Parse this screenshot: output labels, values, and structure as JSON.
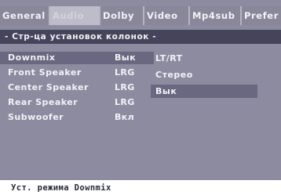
{
  "tabs": [
    {
      "label": "General",
      "active": false
    },
    {
      "label": "Audio",
      "active": true
    },
    {
      "label": "Dolby",
      "active": false
    },
    {
      "label": "Video",
      "active": false
    },
    {
      "label": "Mp4sub",
      "active": false
    },
    {
      "label": "Prefer",
      "active": false
    }
  ],
  "page_title": "- Стр-ца установок колонок -",
  "settings": [
    {
      "label": "Downmix",
      "value": "Вык",
      "selected": true
    },
    {
      "label": "Front Speaker",
      "value": "LRG",
      "selected": false
    },
    {
      "label": "Center Speaker",
      "value": "LRG",
      "selected": false
    },
    {
      "label": "Rear Speaker",
      "value": "LRG",
      "selected": false
    },
    {
      "label": "Subwoofer",
      "value": "Вкл",
      "selected": false
    }
  ],
  "options": [
    {
      "label": "LT/RT",
      "selected": false
    },
    {
      "label": "Стерео",
      "selected": false
    },
    {
      "label": "Вык",
      "selected": true
    }
  ],
  "status_text": "Уст. режима Downmix",
  "colors": {
    "background": "#8d8ba0",
    "heading_bar": "#46445a",
    "highlight": "#6a6880",
    "active_tab": "#bebcc9",
    "text": "#f2f2f6"
  }
}
